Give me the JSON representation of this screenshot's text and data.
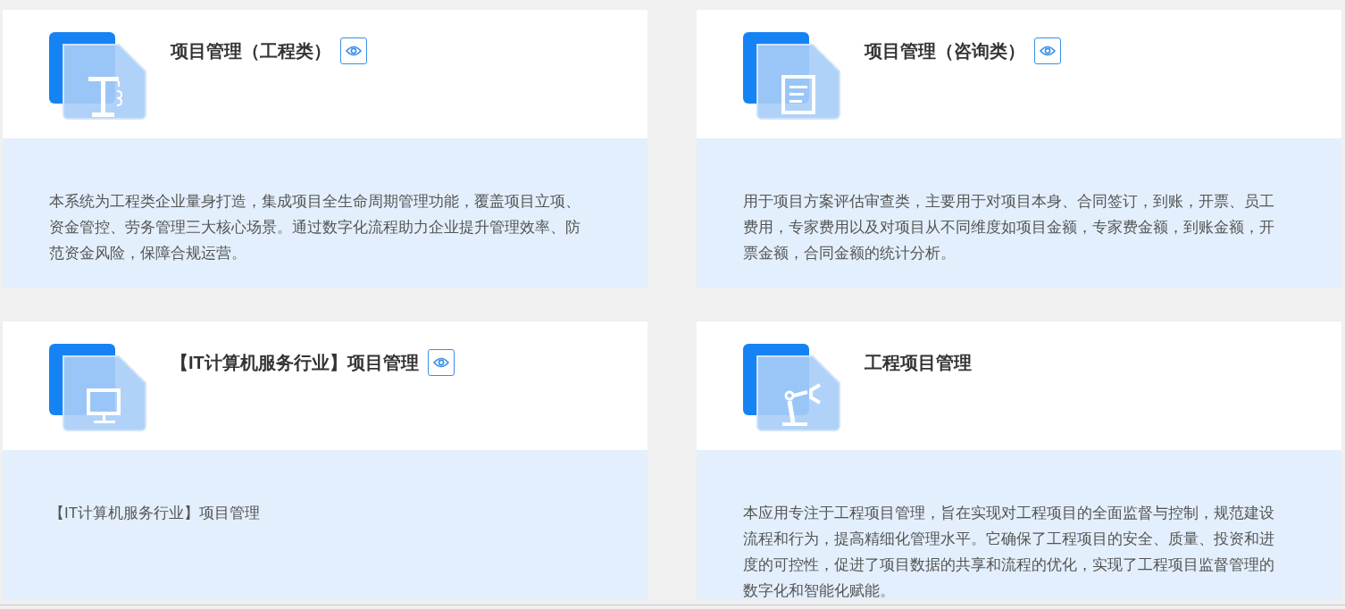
{
  "cards": [
    {
      "kind": "crane",
      "title": "项目管理（工程类）",
      "has_preview": true,
      "description": "本系统为工程类企业量身打造，集成项目全生命周期管理功能，覆盖项目立项、资金管控、劳务管理三大核心场景。通过数字化流程助力企业提升管理效率、防范资金风险，保障合规运营。"
    },
    {
      "kind": "document",
      "title": "项目管理（咨询类）",
      "has_preview": true,
      "description": "用于项目方案评估审查类，主要用于对项目本身、合同签订，到账，开票、员工费用，专家费用以及对项目从不同维度如项目金额，专家费金额，到账金额，开票金额，合同金额的统计分析。"
    },
    {
      "kind": "monitor",
      "title": "【IT计算机服务行业】项目管理",
      "has_preview": true,
      "description": "【IT计算机服务行业】项目管理"
    },
    {
      "kind": "robot-arm",
      "title": "工程项目管理",
      "has_preview": false,
      "description": "本应用专注于工程项目管理，旨在实现对工程项目的全面监督与控制，规范建设流程和行为，提高精细化管理水平。它确保了工程项目的安全、质量、投资和进度的可控性，促进了项目数据的共享和流程的优化，实现了工程项目监督管理的数字化和智能化赋能。"
    }
  ]
}
